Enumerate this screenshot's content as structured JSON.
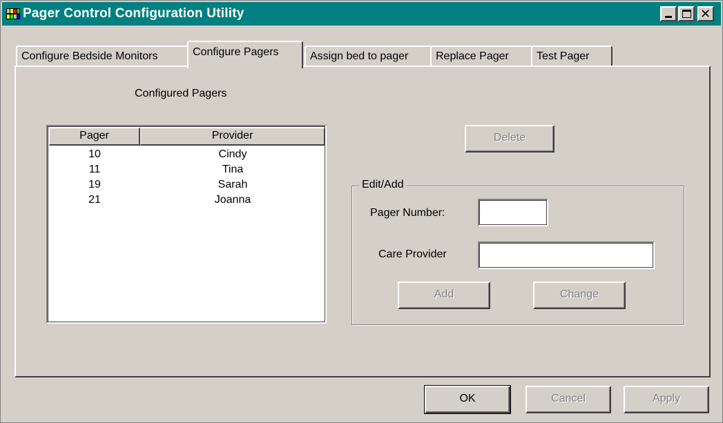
{
  "window": {
    "title": "Pager Control Configuration Utility",
    "title_icon": "app-grid-icon",
    "controls": [
      "minimize-icon",
      "maximize-icon",
      "close-icon"
    ],
    "close_glyph": "✕"
  },
  "tabs": [
    {
      "label": "Configure Bedside Monitors",
      "active": false
    },
    {
      "label": "Configure Pagers",
      "active": true
    },
    {
      "label": "Assign bed to pager",
      "active": false
    },
    {
      "label": "Replace Pager",
      "active": false
    },
    {
      "label": "Test Pager",
      "active": false
    }
  ],
  "panel": {
    "section_label": "Configured Pagers",
    "list": {
      "columns": [
        "Pager",
        "Provider"
      ],
      "rows": [
        {
          "pager": "10",
          "provider": "Cindy"
        },
        {
          "pager": "11",
          "provider": "Tina"
        },
        {
          "pager": "19",
          "provider": "Sarah"
        },
        {
          "pager": "21",
          "provider": "Joanna"
        }
      ]
    },
    "delete_label": "Delete",
    "edit_group": {
      "title": "Edit/Add",
      "pager_number_label": "Pager Number:",
      "pager_number_value": "",
      "care_provider_label": "Care Provider",
      "care_provider_value": "",
      "add_label": "Add",
      "change_label": "Change"
    }
  },
  "footer": {
    "ok_label": "OK",
    "cancel_label": "Cancel",
    "apply_label": "Apply"
  },
  "colors": {
    "titlebar": "#008080",
    "face": "#d4d0c8",
    "disabled_text": "#808080"
  }
}
